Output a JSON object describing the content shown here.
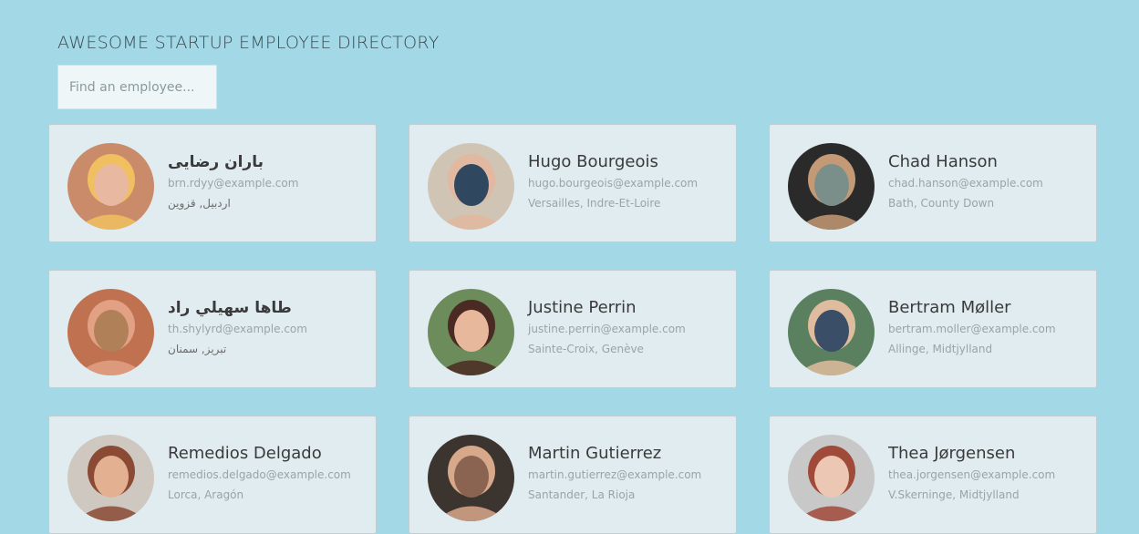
{
  "header": {
    "title": "Awesome Startup Employee Directory",
    "search_placeholder": "Find an employee..."
  },
  "employees": [
    {
      "name": "باران رضایی",
      "email": "brn.rdyy@example.com",
      "location": "اردبیل, قزوین",
      "avatar_colors": [
        "#c98b6a",
        "#f0c060",
        "#e8b8a0"
      ]
    },
    {
      "name": "Hugo Bourgeois",
      "email": "hugo.bourgeois@example.com",
      "location": "Versailles, Indre-Et-Loire",
      "avatar_colors": [
        "#d0c4b4",
        "#e2b8a0",
        "#2f4860"
      ]
    },
    {
      "name": "Chad Hanson",
      "email": "chad.hanson@example.com",
      "location": "Bath, County Down",
      "avatar_colors": [
        "#2a2a2a",
        "#c49a76",
        "#7a8f8a"
      ]
    },
    {
      "name": "طاها سهيلي راد",
      "email": "th.shylyrd@example.com",
      "location": "تبریز, سمنان",
      "avatar_colors": [
        "#c07250",
        "#e2a084",
        "#b08058"
      ]
    },
    {
      "name": "Justine Perrin",
      "email": "justine.perrin@example.com",
      "location": "Sainte-Croix, Genève",
      "avatar_colors": [
        "#6d8c5c",
        "#4a2a22",
        "#e7b89c"
      ]
    },
    {
      "name": "Bertram Møller",
      "email": "bertram.moller@example.com",
      "location": "Allinge, Midtjylland",
      "avatar_colors": [
        "#5a8060",
        "#e0bc9e",
        "#3a4e68"
      ]
    },
    {
      "name": "Remedios Delgado",
      "email": "remedios.delgado@example.com",
      "location": "Lorca, Aragón",
      "avatar_colors": [
        "#cfc8c0",
        "#8a4a34",
        "#e3b092"
      ]
    },
    {
      "name": "Martin Gutierrez",
      "email": "martin.gutierrez@example.com",
      "location": "Santander, La Rioja",
      "avatar_colors": [
        "#3c342e",
        "#d8a88a",
        "#8a6450"
      ]
    },
    {
      "name": "Thea Jørgensen",
      "email": "thea.jorgensen@example.com",
      "location": "V.Skerninge, Midtjylland",
      "avatar_colors": [
        "#c8c8c8",
        "#a04a3a",
        "#ecc8b4"
      ]
    }
  ]
}
